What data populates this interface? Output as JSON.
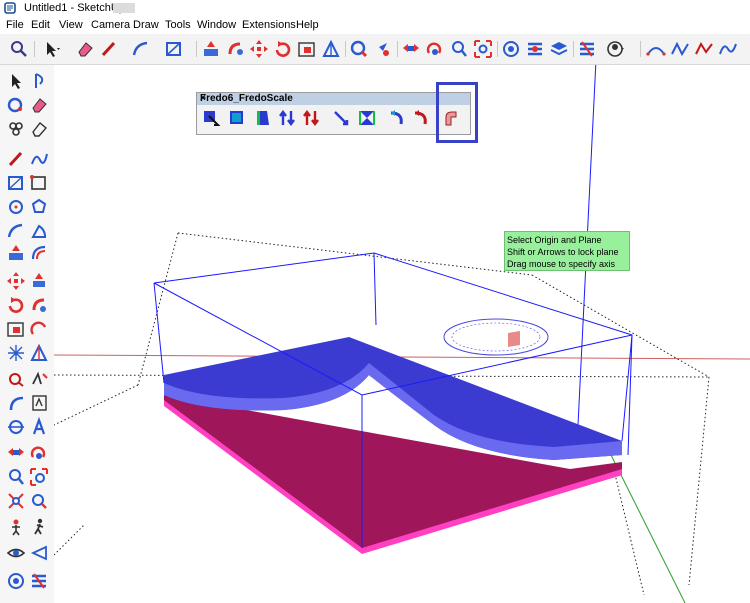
{
  "window": {
    "title": "Untitled1 - SketchUp"
  },
  "menu": [
    "File",
    "Edit",
    "View",
    "Camera",
    "Draw",
    "Tools",
    "Window",
    "Extensions",
    "Help"
  ],
  "toolbar_icons": [
    "search-icon",
    "select-arrow-icon",
    "eraser-icon",
    "pencil-line-icon",
    "arc-icon",
    "rectangle-icon",
    "push-pull-icon",
    "follow-me-icon",
    "move-icon",
    "rotate-icon",
    "scale-icon",
    "tape-measure-icon",
    "paint-bucket-icon",
    "orbit-icon",
    "pan-icon",
    "zoom-icon",
    "zoom-extents-icon",
    "warehouse-icon",
    "extension-icon",
    "layers-icon",
    "profile-icon",
    "bezier-curve-icon",
    "freehand-curve-icon",
    "spline-icon"
  ],
  "left_tool_icons": [
    "select-icon",
    "lasso-icon",
    "paint-icon",
    "eraser-icon",
    "component-icon",
    "pen-icon",
    "line-icon",
    "freehand-icon",
    "rectangle-icon",
    "rotated-rect-icon",
    "circle-icon",
    "polygon-icon",
    "arc-icon",
    "pie-icon",
    "push-pull-icon",
    "offset-icon",
    "move-icon",
    "follow-me-icon",
    "rotate-icon",
    "scale-icon",
    "tape-icon",
    "protractor-icon",
    "dimension-icon",
    "text-icon",
    "axes-icon",
    "3d-text-icon",
    "orbit-icon",
    "pan-icon",
    "zoom-icon",
    "zoom-window-icon",
    "walk-icon",
    "look-around-icon",
    "position-camera-icon",
    "section-icon",
    "eye-icon",
    "warehouse-icon"
  ],
  "fredo_toolbar": {
    "title": "Fredo6_FredoScale",
    "close": "×",
    "buttons": [
      "box-scale-icon",
      "box-stretch-icon",
      "taper-icon",
      "twist-icon",
      "stretch-updown-icon",
      "shear-icon",
      "plane-shear-icon",
      "bend-icon",
      "twist-rotate-icon",
      "radial-bend-icon"
    ],
    "highlighted_button": "radial-bend-icon"
  },
  "tooltip": {
    "line1": "Select Origin and Plane",
    "line2": "Shift or Arrows to lock plane",
    "line3": "Drag mouse to specify axis"
  },
  "colors": {
    "bounding_box": "#0000ff",
    "blue_surface": "#3b3bd2",
    "magenta_base": "#a0165a",
    "magenta_edge": "#ff40c0",
    "highlight": "#3742c7",
    "tooltip_bg": "#98f09c",
    "axis_red": "#c00000",
    "axis_green": "#00a000"
  }
}
